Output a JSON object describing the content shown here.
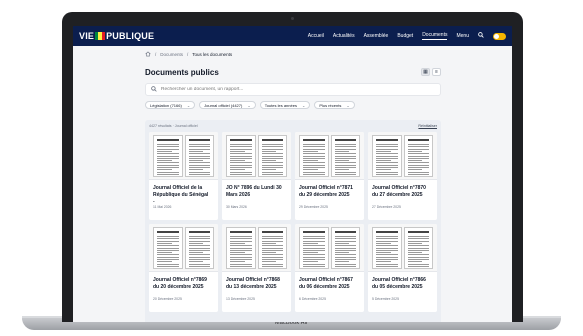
{
  "device": {
    "model": "MacBook Air"
  },
  "nav": {
    "logo_left": "VIE",
    "logo_right": "PUBLIQUE",
    "flag_colors": [
      "#00853f",
      "#fdef42",
      "#e31b23"
    ],
    "links": [
      {
        "label": "Accueil",
        "active": false
      },
      {
        "label": "Actualités",
        "active": false
      },
      {
        "label": "Assemblée",
        "active": false
      },
      {
        "label": "Budget",
        "active": false
      },
      {
        "label": "Documents",
        "active": true
      },
      {
        "label": "Menu",
        "active": false
      }
    ],
    "search_icon": "search-icon",
    "theme_toggle_color": "#f5b400",
    "background": "#0b1e4e"
  },
  "breadcrumb": {
    "items": [
      "Documents",
      "Tous les documents"
    ]
  },
  "page": {
    "title": "Documents publics"
  },
  "search": {
    "placeholder": "Rechercher un document, un rapport..."
  },
  "filters": [
    {
      "label": "Législation (7166)"
    },
    {
      "label": "Journal officiel (4427)"
    },
    {
      "label": "Toutes les années"
    },
    {
      "label": "Plus récents"
    }
  ],
  "results": {
    "summary": "4427 résultats · Journal officiel",
    "reset_label": "Réinitialiser",
    "cards": [
      {
        "title": "Journal Officiel de la République du Sénégal -...",
        "date": "11 Mai 2026"
      },
      {
        "title": "JO N° 7896 du Lundi 30 Mars 2026",
        "date": "30 Mars 2026"
      },
      {
        "title": "Journal Officiel n°7871 du 29 décembre 2025",
        "date": "29 Décembre 2025"
      },
      {
        "title": "Journal Officiel n°7870 du 27 décembre 2025",
        "date": "27 Décembre 2025"
      },
      {
        "title": "Journal Officiel n°7869 du 20 décembre 2025",
        "date": "20 Décembre 2025"
      },
      {
        "title": "Journal Officiel n°7868 du 13 décembre 2025",
        "date": "13 Décembre 2025"
      },
      {
        "title": "Journal Officiel n°7867 du 06 décembre 2025",
        "date": "6 Décembre 2025"
      },
      {
        "title": "Journal Officiel n°7866 du 05 décembre 2025",
        "date": "5 Décembre 2025"
      }
    ]
  }
}
